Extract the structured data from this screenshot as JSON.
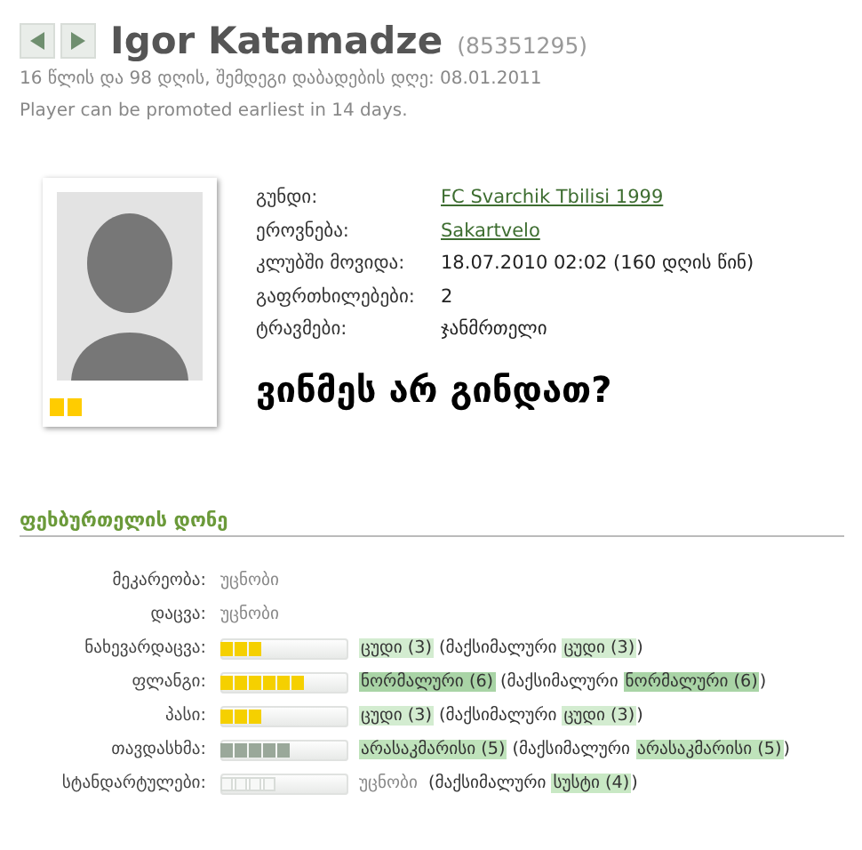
{
  "header": {
    "name": "Igor Katamadze",
    "id": "(85351295)",
    "age_line": "16 წლის და 98 დღის, შემდეგი დაბადების დღე: 08.01.2011",
    "promotion": "Player can be promoted earliest in 14 days."
  },
  "info": [
    {
      "label": "გუნდი:",
      "value": "FC Svarchik Tbilisi 1999",
      "link": true
    },
    {
      "label": "ეროვნება:",
      "value": "Sakartvelo",
      "link": true
    },
    {
      "label": "კლუბში მოვიდა:",
      "value": "18.07.2010 02:02 (160 დღის წინ)",
      "link": false
    },
    {
      "label": "გაფრთხილებები:",
      "value": "2",
      "link": false
    },
    {
      "label": "ტრავმები:",
      "value": "ჯანმრთელი",
      "link": false
    }
  ],
  "slogan": "ვინმეს არ გინდათ?",
  "section_title": "ფეხბურთელის დონე",
  "skills": [
    {
      "label": "მეკარეობა:",
      "kind": "unknown",
      "value": "უცნობი"
    },
    {
      "label": "დაცვა:",
      "kind": "unknown",
      "value": "უცნობი"
    },
    {
      "label": "ნახევარდაცვა:",
      "kind": "bar",
      "level": 0.32,
      "color": "#f5d000",
      "rating": {
        "text": "ცუდი (3)",
        "color": "#d3ecd0"
      },
      "max_prefix": "(მაქსიმალური",
      "max": {
        "text": "ცუდი (3)",
        "color": "#d3ecd0"
      },
      "max_suffix": ")"
    },
    {
      "label": "ფლანგი:",
      "kind": "bar",
      "level": 0.653,
      "color": "#f5d000",
      "rating": {
        "text": "ნორმალური (6)",
        "color": "#a9d4a6"
      },
      "max_prefix": "(მაქსიმალური",
      "max": {
        "text": "ნორმალური (6)",
        "color": "#a9d4a6"
      },
      "max_suffix": ")"
    },
    {
      "label": "პასი:",
      "kind": "bar",
      "level": 0.32,
      "color": "#f5d000",
      "rating": {
        "text": "ცუდი (3)",
        "color": "#d3ecd0"
      },
      "max_prefix": "(მაქსიმალური",
      "max": {
        "text": "ცუდი (3)",
        "color": "#d3ecd0"
      },
      "max_suffix": ")"
    },
    {
      "label": "თავდასხმა:",
      "kind": "bar",
      "level": 0.542,
      "color": "#9aa89a",
      "rating": {
        "text": "არასაკმარისი (5)",
        "color": "#bfe3bb"
      },
      "max_prefix": "(მაქსიმალური",
      "max": {
        "text": "არასაკმარისი (5)",
        "color": "#bfe3bb"
      },
      "max_suffix": ")"
    },
    {
      "label": "სტანდარტულები:",
      "kind": "bar-hollow",
      "level": 0.431,
      "color": "#d8dcd8",
      "rating": {
        "text": "უცნობი"
      },
      "max_prefix": "(მაქსიმალური",
      "max": {
        "text": "სუსტი (4)",
        "color": "#c8e8c4"
      },
      "max_suffix": ")"
    }
  ]
}
